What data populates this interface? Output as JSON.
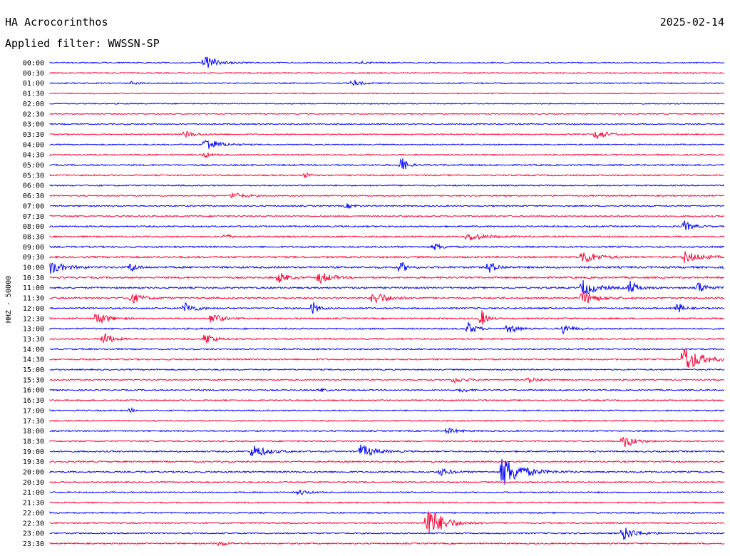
{
  "header": {
    "station": "HA Acrocorinthos",
    "date": "2025-02-14",
    "filter": "Applied filter: WWSSN-SP"
  },
  "chart_data": {
    "type": "line",
    "title": "HA Acrocorinthos",
    "subtitle": "Applied filter: WWSSN-SP",
    "ylabel": "HHZ - 50000",
    "colors": [
      "#0000ff",
      "#ff0033"
    ],
    "grid": false,
    "rows": [
      "00:00",
      "00:30",
      "01:00",
      "01:30",
      "02:00",
      "02:30",
      "03:00",
      "03:30",
      "04:00",
      "04:30",
      "05:00",
      "05:30",
      "06:00",
      "06:30",
      "07:00",
      "07:30",
      "08:00",
      "08:30",
      "09:00",
      "09:30",
      "10:00",
      "10:30",
      "11:00",
      "11:30",
      "12:00",
      "12:30",
      "13:00",
      "13:30",
      "14:00",
      "14:30",
      "15:00",
      "15:30",
      "16:00",
      "16:30",
      "17:00",
      "17:30",
      "18:00",
      "18:30",
      "19:00",
      "19:30",
      "20:00",
      "20:30",
      "21:00",
      "21:30",
      "22:00",
      "22:30",
      "23:00",
      "23:30"
    ],
    "noise": [
      0.8,
      0.8,
      0.8,
      0.7,
      0.7,
      0.7,
      0.8,
      0.8,
      0.8,
      0.9,
      1.0,
      0.9,
      0.9,
      0.9,
      0.9,
      0.9,
      1.0,
      1.0,
      1.1,
      1.2,
      1.3,
      1.2,
      1.1,
      1.1,
      1.0,
      1.0,
      1.0,
      1.0,
      1.0,
      1.0,
      0.9,
      0.9,
      0.9,
      0.9,
      0.9,
      0.9,
      0.9,
      0.9,
      1.0,
      1.0,
      1.0,
      0.9,
      0.9,
      0.9,
      0.9,
      0.9,
      0.9,
      0.9
    ],
    "events": [
      {
        "row": "00:00",
        "x": 0.23,
        "amp": 10,
        "dur": 0.05
      },
      {
        "row": "00:00",
        "x": 0.46,
        "amp": 2,
        "dur": 0.03
      },
      {
        "row": "01:00",
        "x": 0.45,
        "amp": 4,
        "dur": 0.03
      },
      {
        "row": "01:00",
        "x": 0.12,
        "amp": 2,
        "dur": 0.03
      },
      {
        "row": "03:30",
        "x": 0.2,
        "amp": 5,
        "dur": 0.04
      },
      {
        "row": "03:30",
        "x": 0.81,
        "amp": 8,
        "dur": 0.04
      },
      {
        "row": "04:00",
        "x": 0.23,
        "amp": 10,
        "dur": 0.05
      },
      {
        "row": "04:30",
        "x": 0.23,
        "amp": 4,
        "dur": 0.02
      },
      {
        "row": "05:00",
        "x": 0.52,
        "amp": 14,
        "dur": 0.02
      },
      {
        "row": "05:30",
        "x": 0.38,
        "amp": 5,
        "dur": 0.01
      },
      {
        "row": "06:30",
        "x": 0.27,
        "amp": 5,
        "dur": 0.04
      },
      {
        "row": "07:00",
        "x": 0.44,
        "amp": 3,
        "dur": 0.03
      },
      {
        "row": "08:00",
        "x": 0.94,
        "amp": 8,
        "dur": 0.03
      },
      {
        "row": "08:30",
        "x": 0.62,
        "amp": 6,
        "dur": 0.06
      },
      {
        "row": "08:30",
        "x": 0.26,
        "amp": 4,
        "dur": 0.02
      },
      {
        "row": "09:00",
        "x": 0.57,
        "amp": 5,
        "dur": 0.03
      },
      {
        "row": "09:30",
        "x": 0.79,
        "amp": 10,
        "dur": 0.05
      },
      {
        "row": "09:30",
        "x": 0.94,
        "amp": 8,
        "dur": 0.06
      },
      {
        "row": "10:00",
        "x": 0.0,
        "amp": 9,
        "dur": 0.05
      },
      {
        "row": "10:00",
        "x": 0.12,
        "amp": 8,
        "dur": 0.02
      },
      {
        "row": "10:00",
        "x": 0.52,
        "amp": 9,
        "dur": 0.02
      },
      {
        "row": "10:00",
        "x": 0.65,
        "amp": 9,
        "dur": 0.03
      },
      {
        "row": "10:30",
        "x": 0.34,
        "amp": 8,
        "dur": 0.03
      },
      {
        "row": "10:30",
        "x": 0.4,
        "amp": 9,
        "dur": 0.04
      },
      {
        "row": "11:00",
        "x": 0.79,
        "amp": 12,
        "dur": 0.05
      },
      {
        "row": "11:00",
        "x": 0.86,
        "amp": 10,
        "dur": 0.03
      },
      {
        "row": "11:00",
        "x": 0.96,
        "amp": 10,
        "dur": 0.03
      },
      {
        "row": "11:30",
        "x": 0.12,
        "amp": 8,
        "dur": 0.04
      },
      {
        "row": "11:30",
        "x": 0.48,
        "amp": 10,
        "dur": 0.05
      },
      {
        "row": "11:30",
        "x": 0.79,
        "amp": 10,
        "dur": 0.05
      },
      {
        "row": "12:00",
        "x": 0.2,
        "amp": 8,
        "dur": 0.04
      },
      {
        "row": "12:00",
        "x": 0.39,
        "amp": 10,
        "dur": 0.02
      },
      {
        "row": "12:00",
        "x": 0.93,
        "amp": 10,
        "dur": 0.02
      },
      {
        "row": "12:30",
        "x": 0.07,
        "amp": 10,
        "dur": 0.04
      },
      {
        "row": "12:30",
        "x": 0.24,
        "amp": 10,
        "dur": 0.03
      },
      {
        "row": "12:30",
        "x": 0.64,
        "amp": 12,
        "dur": 0.02
      },
      {
        "row": "13:00",
        "x": 0.62,
        "amp": 9,
        "dur": 0.03
      },
      {
        "row": "13:00",
        "x": 0.68,
        "amp": 8,
        "dur": 0.03
      },
      {
        "row": "13:00",
        "x": 0.76,
        "amp": 8,
        "dur": 0.03
      },
      {
        "row": "13:30",
        "x": 0.08,
        "amp": 10,
        "dur": 0.03
      },
      {
        "row": "13:30",
        "x": 0.23,
        "amp": 10,
        "dur": 0.03
      },
      {
        "row": "14:30",
        "x": 0.94,
        "amp": 20,
        "dur": 0.06
      },
      {
        "row": "15:30",
        "x": 0.6,
        "amp": 4,
        "dur": 0.04
      },
      {
        "row": "15:30",
        "x": 0.71,
        "amp": 4,
        "dur": 0.04
      },
      {
        "row": "16:00",
        "x": 0.4,
        "amp": 3,
        "dur": 0.02
      },
      {
        "row": "16:00",
        "x": 0.61,
        "amp": 3,
        "dur": 0.03
      },
      {
        "row": "17:00",
        "x": 0.12,
        "amp": 4,
        "dur": 0.01
      },
      {
        "row": "18:00",
        "x": 0.59,
        "amp": 4,
        "dur": 0.04
      },
      {
        "row": "18:30",
        "x": 0.85,
        "amp": 10,
        "dur": 0.04
      },
      {
        "row": "19:00",
        "x": 0.3,
        "amp": 10,
        "dur": 0.05
      },
      {
        "row": "19:00",
        "x": 0.46,
        "amp": 10,
        "dur": 0.05
      },
      {
        "row": "20:00",
        "x": 0.58,
        "amp": 5,
        "dur": 0.04
      },
      {
        "row": "20:00",
        "x": 0.67,
        "amp": 24,
        "dur": 0.07
      },
      {
        "row": "21:00",
        "x": 0.37,
        "amp": 4,
        "dur": 0.03
      },
      {
        "row": "22:30",
        "x": 0.56,
        "amp": 24,
        "dur": 0.06
      },
      {
        "row": "23:00",
        "x": 0.85,
        "amp": 10,
        "dur": 0.05
      },
      {
        "row": "23:30",
        "x": 0.25,
        "amp": 4,
        "dur": 0.03
      }
    ]
  }
}
